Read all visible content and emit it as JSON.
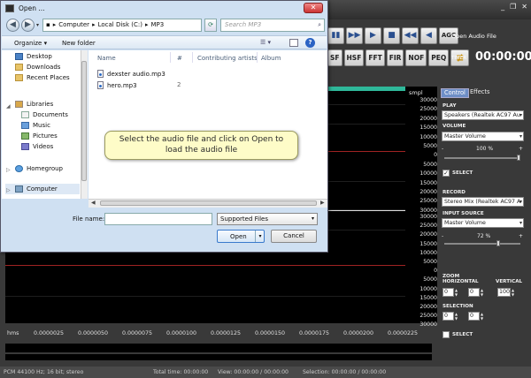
{
  "editor": {
    "toolbar_top": [
      "▮▮",
      "▶▶",
      "▶",
      "■",
      "◀◀",
      "◀"
    ],
    "agc_label": "AGC",
    "open_audio_label": "Open Audio File",
    "fx_buttons": [
      "SF",
      "HSF",
      "FFT",
      "FIR",
      "NOF",
      "PEQ"
    ],
    "timer_label": "TIMER",
    "timer_value": "00:00:00",
    "smpl_label": "smpl",
    "scale_top": [
      "30000",
      "25000",
      "20000",
      "15000",
      "10000",
      "5000",
      "0",
      "5000",
      "10000",
      "15000",
      "20000",
      "25000",
      "30000"
    ],
    "scale_bottom": [
      "30000",
      "25000",
      "20000",
      "15000",
      "10000",
      "5000",
      "0",
      "5000",
      "10000",
      "15000",
      "20000",
      "25000",
      "30000"
    ],
    "time_ruler": {
      "unit": "hms",
      "ticks": [
        "0.0000025",
        "0.0000050",
        "0.0000075",
        "0.0000100",
        "0.0000125",
        "0.0000150",
        "0.0000175",
        "0.0000200",
        "0.0000225"
      ]
    },
    "status": {
      "format": "PCM 44100 Hz; 16 bit; stereo",
      "total_time": "Total time: 00:00:00",
      "view": "View: 00:00:00 / 00:00:00",
      "selection": "Selection: 00:00:00 / 00:00:00"
    },
    "panel": {
      "tab_control": "Control",
      "tab_effects": "Effects",
      "play_label": "PLAY",
      "play_device": "Speakers (Realtek AC97 Au",
      "volume_label": "VOLUME",
      "volume_device": "Master Volume",
      "volume_pct": "100 %",
      "volume_level": 1.0,
      "select_label": "SELECT",
      "record_label": "RECORD",
      "record_device": "Stereo Mix (Realtek AC97 A",
      "input_source_label": "INPUT SOURCE",
      "input_source": "Master Volume",
      "input_pct": "72 %",
      "input_level": 0.72,
      "zoom_label": "ZOOM",
      "horizontal_label": "HORIZONTAL",
      "vertical_label": "VERTICAL",
      "zoom_h1": "0",
      "zoom_h2": "0",
      "zoom_v": "100",
      "selection_label": "SELECTION",
      "sel_1": "0",
      "sel_2": "0",
      "select2_label": "SELECT"
    }
  },
  "dialog": {
    "title": "Open ...",
    "close_glyph": "✕",
    "back_glyph": "◀",
    "forward_glyph": "▶",
    "nav_dropdown_glyph": "▾",
    "address": [
      "Computer",
      "Local Disk (C:)",
      "MP3"
    ],
    "address_sep": "▸",
    "refresh_glyph": "⟳",
    "search_placeholder": "Search MP3",
    "search_glyph": "⌕",
    "organize": "Organize ▾",
    "new_folder": "New folder",
    "views_glyph": "☰ ▾",
    "help_glyph": "?",
    "nav_items": [
      {
        "label": "Desktop",
        "icon": "desktop-icon",
        "cls": "blue"
      },
      {
        "label": "Downloads",
        "icon": "downloads-icon",
        "cls": "folder"
      },
      {
        "label": "Recent Places",
        "icon": "recent-places-icon",
        "cls": "folder"
      }
    ],
    "libraries": "Libraries",
    "library_items": [
      {
        "label": "Documents",
        "icon": "documents-icon",
        "cls": "doc"
      },
      {
        "label": "Music",
        "icon": "music-icon",
        "cls": "music"
      },
      {
        "label": "Pictures",
        "icon": "pictures-icon",
        "cls": "pic"
      },
      {
        "label": "Videos",
        "icon": "videos-icon",
        "cls": "vid"
      }
    ],
    "homegroup": "Homegroup",
    "computer": "Computer",
    "columns": {
      "name": "Name",
      "num": "#",
      "artists": "Contributing artists",
      "album": "Album"
    },
    "files": [
      {
        "name": "dexster audio.mp3",
        "num": ""
      },
      {
        "name": "hero.mp3",
        "num": "2"
      }
    ],
    "file_name_label": "File name:",
    "file_name_value": "",
    "file_type": "Supported Files",
    "open_label": "Open",
    "cancel_label": "Cancel"
  },
  "callout": {
    "line1": "Select the audio file and click on Open to",
    "line2": "load the audio file"
  },
  "colors": {
    "waveform_bg": "#000000",
    "center_line": "#a02323",
    "accent_strip": "#2fb89a",
    "panel_bg": "#393939",
    "dialog_bg": "#cfe0f2",
    "callout_bg": "#fefcc8"
  }
}
